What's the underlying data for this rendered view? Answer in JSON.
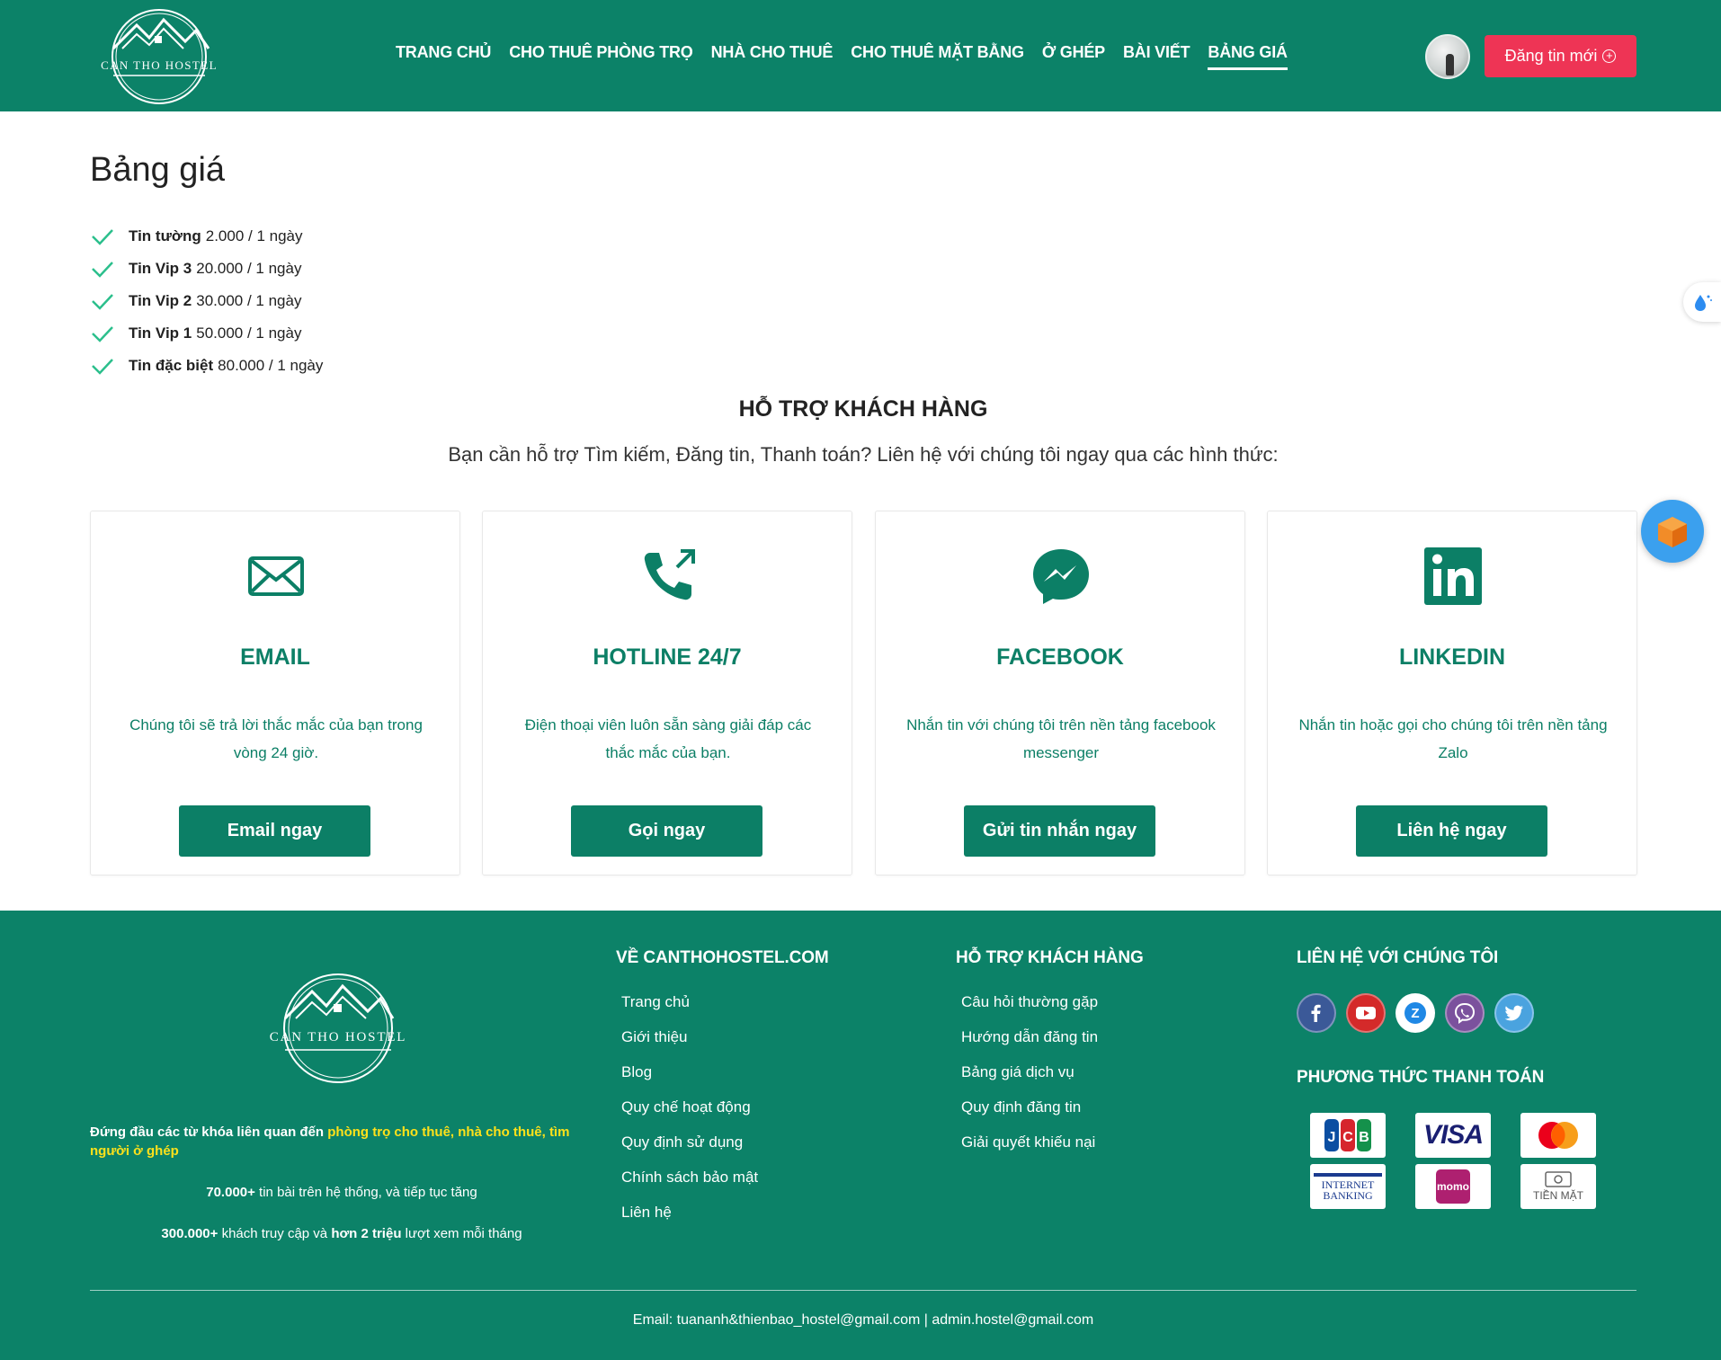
{
  "header": {
    "logo_text": "CAN THO HOSTEL",
    "nav": [
      {
        "label": "TRANG CHỦ"
      },
      {
        "label": "CHO THUÊ PHÒNG TRỌ"
      },
      {
        "label": "NHÀ CHO THUÊ"
      },
      {
        "label": "CHO THUÊ MẶT BẰNG"
      },
      {
        "label": "Ở GHÉP"
      },
      {
        "label": "BÀI VIẾT"
      },
      {
        "label": "BẢNG GIÁ"
      }
    ],
    "active_nav": "BẢNG GIÁ",
    "post_button": "Đăng tin mới"
  },
  "pricing": {
    "title": "Bảng giá",
    "items": [
      {
        "name": "Tin tường",
        "price": "2.000 / 1 ngày"
      },
      {
        "name": "Tin Vip 3",
        "price": "20.000 / 1 ngày"
      },
      {
        "name": "Tin Vip 2",
        "price": "30.000 / 1 ngày"
      },
      {
        "name": "Tin Vip 1",
        "price": "50.000 / 1 ngày"
      },
      {
        "name": "Tin đặc biệt",
        "price": "80.000 / 1 ngày"
      }
    ]
  },
  "support": {
    "title": "HỖ TRỢ KHÁCH HÀNG",
    "subtitle": "Bạn cần hỗ trợ Tìm kiếm, Đăng tin, Thanh toán? Liên hệ với chúng tôi ngay qua các hình thức:",
    "cards": [
      {
        "icon": "envelope-icon",
        "title": "EMAIL",
        "desc": "Chúng tôi sẽ trả lời thắc mắc của bạn trong vòng 24 giờ.",
        "button": "Email ngay"
      },
      {
        "icon": "phone-call-icon",
        "title": "HOTLINE 24/7",
        "desc": "Điện thoại viên luôn sẵn sàng giải đáp các thắc mắc của bạn.",
        "button": "Gọi ngay"
      },
      {
        "icon": "messenger-icon",
        "title": "FACEBOOK",
        "desc": "Nhắn tin với chúng tôi trên nền tảng facebook messenger",
        "button": "Gửi tin nhắn ngay"
      },
      {
        "icon": "linkedin-icon",
        "title": "LINKEDIN",
        "desc": "Nhắn tin hoặc gọi cho chúng tôi trên nền tảng Zalo",
        "button": "Liên hệ ngay"
      }
    ]
  },
  "footer": {
    "logo_text": "CAN THO HOSTEL",
    "about_prefix": "Đứng đầu các từ khóa liên quan đến ",
    "about_hl1": "phòng trọ cho thuê",
    "about_sep1": ", ",
    "about_hl2": "nhà cho thuê",
    "about_sep2": ", ",
    "about_hl3": "tìm người ở ghép",
    "stat1_bold": "70.000+",
    "stat1_text": " tin bài trên hệ thống, và tiếp tục tăng",
    "stat2_bold1": "300.000+",
    "stat2_text1": " khách truy cập và ",
    "stat2_bold2": "hơn 2 triệu",
    "stat2_text2": " lượt xem mỗi tháng",
    "col_about": {
      "title": "VỀ CANTHOHOSTEL.COM",
      "links": [
        "Trang chủ",
        "Giới thiệu",
        "Blog",
        "Quy chế hoạt động",
        "Quy định sử dụng",
        "Chính sách bảo mật",
        "Liên hệ"
      ]
    },
    "col_support": {
      "title": "HỖ TRỢ KHÁCH HÀNG",
      "links": [
        "Câu hỏi thường gặp",
        "Hướng dẫn đăng tin",
        "Bảng giá dịch vụ",
        "Quy định đăng tin",
        "Giải quyết khiếu nại"
      ]
    },
    "col_contact": {
      "title": "LIÊN HỆ VỚI CHÚNG TÔI",
      "social": [
        "facebook-icon",
        "youtube-icon",
        "zalo-icon",
        "viber-icon",
        "twitter-icon"
      ]
    },
    "payment": {
      "title": "PHƯƠNG THỨC THANH TOÁN",
      "methods": [
        "JCB",
        "VISA",
        "mastercard",
        "INTERNET BANKING",
        "momo",
        "TIỀN MẶT"
      ]
    },
    "copyright": "Email: tuananh&thienbao_hostel@gmail.com | admin.hostel@gmail.com"
  },
  "colors": {
    "primary": "#0c8268",
    "accent_button": "#ee3455",
    "highlight": "#ffe11a"
  }
}
